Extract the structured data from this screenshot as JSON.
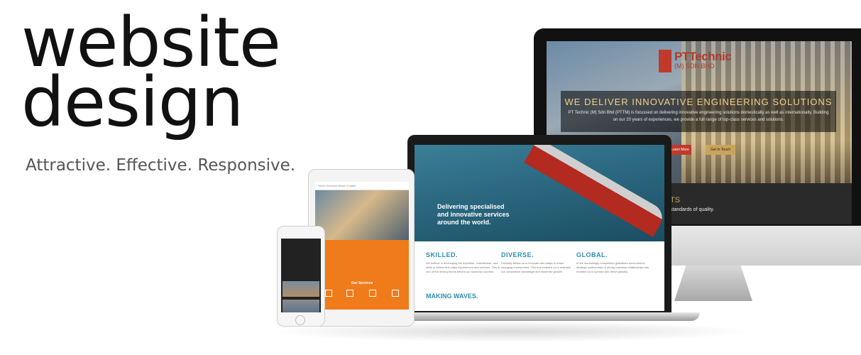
{
  "hero": {
    "line1": "website",
    "line2": "design",
    "tagline": "Attractive. Effective. Responsive."
  },
  "desktop_site": {
    "logo_text": "PTTechnic",
    "logo_sub": "(M) SDN BHD",
    "headline": "WE DELIVER INNOVATIVE ENGINEERING SOLUTIONS",
    "body": "PT Technic (M) Sdn Bhd (PTTM) is focussed on delivering innovative engineering solutions domestically as well as internationally. Building on our 20 years of experiences, we provide a full range of top-class services and solutions.",
    "learn_more": "Learn More",
    "get_in_touch": "Get In Touch",
    "band_title": "TS",
    "band_text": "standards of quality."
  },
  "laptop_site": {
    "hero_text": "Delivering specialised\nand innovative services\naround the world.",
    "columns": [
      {
        "title": "SKILLED.",
        "text": "We believe in developing the expertise, commitment, and skills to deliver first-class experiences and services. This is one of the driving forces behind our business success."
      },
      {
        "title": "DIVERSE.",
        "text": "Diversity allows us to innovate and adapt in a fast-changing environment. This has enabled us to maintain our competitive advantage and maximise growth."
      },
      {
        "title": "GLOBAL.",
        "text": "In the increasingly competitive globalised environment, strategic partnerships & strong business relationships has enabled us to operate and thrive globally."
      }
    ],
    "section_title": "MAKING WAVES."
  },
  "tablet_site": {
    "nav": "Home  Services  About  Contact",
    "services_title": "Our Services"
  },
  "colors": {
    "accent_blue": "#2a8db5",
    "accent_red": "#c0392b",
    "accent_orange": "#f07b1a",
    "gold": "#c9a45a"
  }
}
